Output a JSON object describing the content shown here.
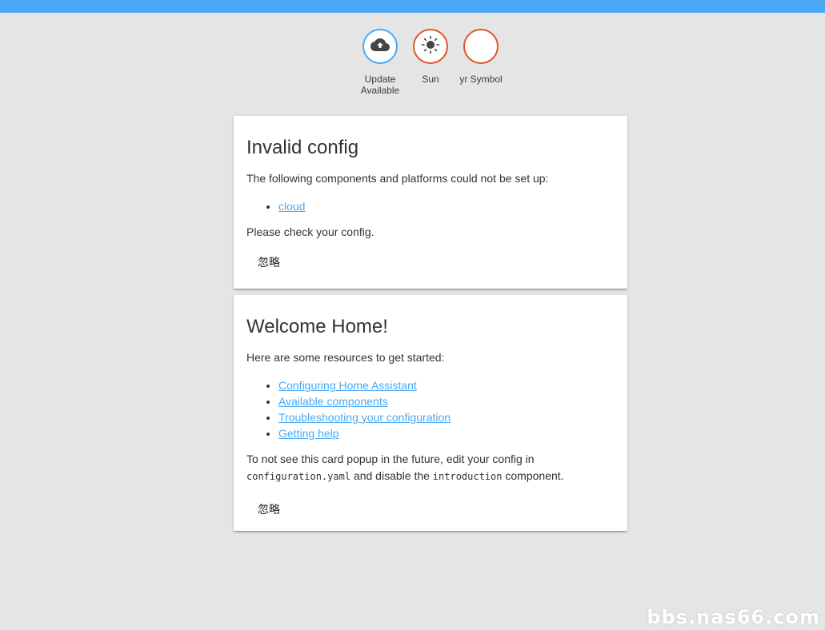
{
  "badges": [
    {
      "label": "Update Available",
      "icon": "cloud-upload-icon",
      "color": "#4aa8f5"
    },
    {
      "label": "Sun",
      "icon": "sun-icon",
      "color": "#e0552e"
    },
    {
      "label": "yr Symbol",
      "icon": "",
      "color": "#e0552e"
    }
  ],
  "invalid_config": {
    "title": "Invalid config",
    "intro": "The following components and platforms could not be set up:",
    "items": [
      "cloud"
    ],
    "footer": "Please check your config.",
    "dismiss": "忽略"
  },
  "welcome": {
    "title": "Welcome Home!",
    "intro": "Here are some resources to get started:",
    "links": [
      "Configuring Home Assistant",
      "Available components",
      "Troubleshooting your configuration",
      "Getting help"
    ],
    "footer_pre": "To not see this card popup in the future, edit your config in",
    "footer_code1": "configuration.yaml",
    "footer_mid": "and disable the",
    "footer_code2": "introduction",
    "footer_post": "component.",
    "dismiss": "忽略"
  },
  "watermark": "bbs.nas66.com",
  "colors": {
    "primary": "#4aa8f5",
    "badge_border": "#e0552e",
    "background": "#e5e5e5"
  }
}
